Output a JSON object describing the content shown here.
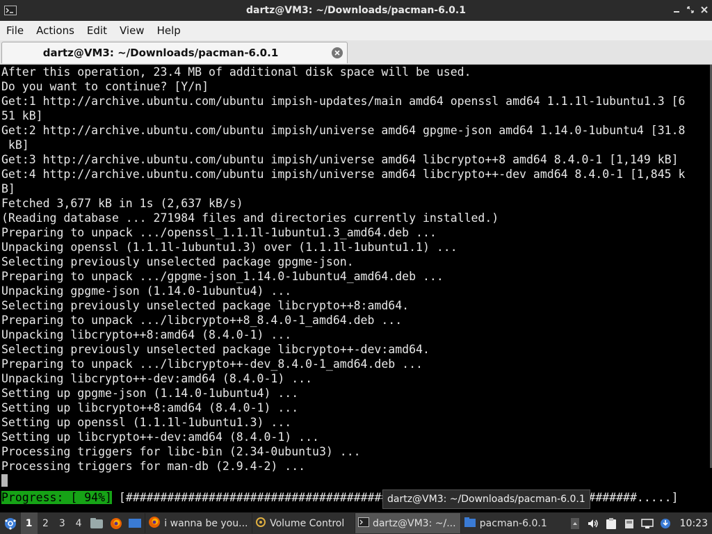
{
  "window": {
    "title": "dartz@VM3: ~/Downloads/pacman-6.0.1"
  },
  "menu": [
    "File",
    "Actions",
    "Edit",
    "View",
    "Help"
  ],
  "tab": {
    "label": "dartz@VM3: ~/Downloads/pacman-6.0.1"
  },
  "terminal": {
    "lines": [
      "After this operation, 23.4 MB of additional disk space will be used.",
      "Do you want to continue? [Y/n]",
      "Get:1 http://archive.ubuntu.com/ubuntu impish-updates/main amd64 openssl amd64 1.1.1l-1ubuntu1.3 [6",
      "51 kB]",
      "Get:2 http://archive.ubuntu.com/ubuntu impish/universe amd64 gpgme-json amd64 1.14.0-1ubuntu4 [31.8",
      " kB]",
      "Get:3 http://archive.ubuntu.com/ubuntu impish/universe amd64 libcrypto++8 amd64 8.4.0-1 [1,149 kB]",
      "Get:4 http://archive.ubuntu.com/ubuntu impish/universe amd64 libcrypto++-dev amd64 8.4.0-1 [1,845 k",
      "B]",
      "Fetched 3,677 kB in 1s (2,637 kB/s)",
      "(Reading database ... 271984 files and directories currently installed.)",
      "Preparing to unpack .../openssl_1.1.1l-1ubuntu1.3_amd64.deb ...",
      "Unpacking openssl (1.1.1l-1ubuntu1.3) over (1.1.1l-1ubuntu1.1) ...",
      "Selecting previously unselected package gpgme-json.",
      "Preparing to unpack .../gpgme-json_1.14.0-1ubuntu4_amd64.deb ...",
      "Unpacking gpgme-json (1.14.0-1ubuntu4) ...",
      "Selecting previously unselected package libcrypto++8:amd64.",
      "Preparing to unpack .../libcrypto++8_8.4.0-1_amd64.deb ...",
      "Unpacking libcrypto++8:amd64 (8.4.0-1) ...",
      "Selecting previously unselected package libcrypto++-dev:amd64.",
      "Preparing to unpack .../libcrypto++-dev_8.4.0-1_amd64.deb ...",
      "Unpacking libcrypto++-dev:amd64 (8.4.0-1) ...",
      "Setting up gpgme-json (1.14.0-1ubuntu4) ...",
      "Setting up libcrypto++8:amd64 (8.4.0-1) ...",
      "Setting up openssl (1.1.1l-1ubuntu1.3) ...",
      "Setting up libcrypto++-dev:amd64 (8.4.0-1) ...",
      "Processing triggers for libc-bin (2.34-0ubuntu3) ...",
      "Processing triggers for man-db (2.9.4-2) ..."
    ],
    "progress": {
      "label": "Progress: [ 94%]",
      "bar": "[##########################################################################.....]",
      "percent": 94
    }
  },
  "tooltip": "dartz@VM3: ~/Downloads/pacman-6.0.1",
  "taskbar": {
    "workspaces": [
      "1",
      "2",
      "3",
      "4"
    ],
    "active_workspace": "1",
    "tasks": [
      {
        "icon": "firefox-icon",
        "label": "i wanna be you..."
      },
      {
        "icon": "volume-control-icon",
        "label": "Volume Control"
      },
      {
        "icon": "terminal-icon",
        "label": "dartz@VM3: ~/..."
      },
      {
        "icon": "folder-icon",
        "label": "pacman-6.0.1"
      }
    ],
    "clock": "10:23",
    "colors": {
      "progress_bg": "#16a316",
      "panel_bg": "#2f2f2f",
      "titlebar_bg": "#2b2b2b"
    }
  }
}
